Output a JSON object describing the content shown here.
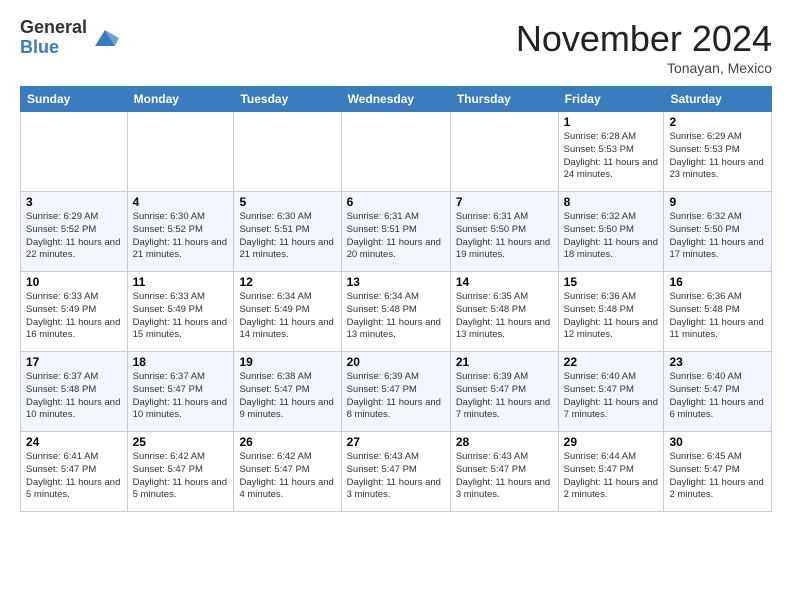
{
  "logo": {
    "general": "General",
    "blue": "Blue"
  },
  "header": {
    "month": "November 2024",
    "location": "Tonayan, Mexico"
  },
  "weekdays": [
    "Sunday",
    "Monday",
    "Tuesday",
    "Wednesday",
    "Thursday",
    "Friday",
    "Saturday"
  ],
  "weeks": [
    [
      {
        "day": "",
        "info": ""
      },
      {
        "day": "",
        "info": ""
      },
      {
        "day": "",
        "info": ""
      },
      {
        "day": "",
        "info": ""
      },
      {
        "day": "",
        "info": ""
      },
      {
        "day": "1",
        "info": "Sunrise: 6:28 AM\nSunset: 5:53 PM\nDaylight: 11 hours and 24 minutes."
      },
      {
        "day": "2",
        "info": "Sunrise: 6:29 AM\nSunset: 5:53 PM\nDaylight: 11 hours and 23 minutes."
      }
    ],
    [
      {
        "day": "3",
        "info": "Sunrise: 6:29 AM\nSunset: 5:52 PM\nDaylight: 11 hours and 22 minutes."
      },
      {
        "day": "4",
        "info": "Sunrise: 6:30 AM\nSunset: 5:52 PM\nDaylight: 11 hours and 21 minutes."
      },
      {
        "day": "5",
        "info": "Sunrise: 6:30 AM\nSunset: 5:51 PM\nDaylight: 11 hours and 21 minutes."
      },
      {
        "day": "6",
        "info": "Sunrise: 6:31 AM\nSunset: 5:51 PM\nDaylight: 11 hours and 20 minutes."
      },
      {
        "day": "7",
        "info": "Sunrise: 6:31 AM\nSunset: 5:50 PM\nDaylight: 11 hours and 19 minutes."
      },
      {
        "day": "8",
        "info": "Sunrise: 6:32 AM\nSunset: 5:50 PM\nDaylight: 11 hours and 18 minutes."
      },
      {
        "day": "9",
        "info": "Sunrise: 6:32 AM\nSunset: 5:50 PM\nDaylight: 11 hours and 17 minutes."
      }
    ],
    [
      {
        "day": "10",
        "info": "Sunrise: 6:33 AM\nSunset: 5:49 PM\nDaylight: 11 hours and 16 minutes."
      },
      {
        "day": "11",
        "info": "Sunrise: 6:33 AM\nSunset: 5:49 PM\nDaylight: 11 hours and 15 minutes."
      },
      {
        "day": "12",
        "info": "Sunrise: 6:34 AM\nSunset: 5:49 PM\nDaylight: 11 hours and 14 minutes."
      },
      {
        "day": "13",
        "info": "Sunrise: 6:34 AM\nSunset: 5:48 PM\nDaylight: 11 hours and 13 minutes."
      },
      {
        "day": "14",
        "info": "Sunrise: 6:35 AM\nSunset: 5:48 PM\nDaylight: 11 hours and 13 minutes."
      },
      {
        "day": "15",
        "info": "Sunrise: 6:36 AM\nSunset: 5:48 PM\nDaylight: 11 hours and 12 minutes."
      },
      {
        "day": "16",
        "info": "Sunrise: 6:36 AM\nSunset: 5:48 PM\nDaylight: 11 hours and 11 minutes."
      }
    ],
    [
      {
        "day": "17",
        "info": "Sunrise: 6:37 AM\nSunset: 5:48 PM\nDaylight: 11 hours and 10 minutes."
      },
      {
        "day": "18",
        "info": "Sunrise: 6:37 AM\nSunset: 5:47 PM\nDaylight: 11 hours and 10 minutes."
      },
      {
        "day": "19",
        "info": "Sunrise: 6:38 AM\nSunset: 5:47 PM\nDaylight: 11 hours and 9 minutes."
      },
      {
        "day": "20",
        "info": "Sunrise: 6:39 AM\nSunset: 5:47 PM\nDaylight: 11 hours and 8 minutes."
      },
      {
        "day": "21",
        "info": "Sunrise: 6:39 AM\nSunset: 5:47 PM\nDaylight: 11 hours and 7 minutes."
      },
      {
        "day": "22",
        "info": "Sunrise: 6:40 AM\nSunset: 5:47 PM\nDaylight: 11 hours and 7 minutes."
      },
      {
        "day": "23",
        "info": "Sunrise: 6:40 AM\nSunset: 5:47 PM\nDaylight: 11 hours and 6 minutes."
      }
    ],
    [
      {
        "day": "24",
        "info": "Sunrise: 6:41 AM\nSunset: 5:47 PM\nDaylight: 11 hours and 5 minutes."
      },
      {
        "day": "25",
        "info": "Sunrise: 6:42 AM\nSunset: 5:47 PM\nDaylight: 11 hours and 5 minutes."
      },
      {
        "day": "26",
        "info": "Sunrise: 6:42 AM\nSunset: 5:47 PM\nDaylight: 11 hours and 4 minutes."
      },
      {
        "day": "27",
        "info": "Sunrise: 6:43 AM\nSunset: 5:47 PM\nDaylight: 11 hours and 3 minutes."
      },
      {
        "day": "28",
        "info": "Sunrise: 6:43 AM\nSunset: 5:47 PM\nDaylight: 11 hours and 3 minutes."
      },
      {
        "day": "29",
        "info": "Sunrise: 6:44 AM\nSunset: 5:47 PM\nDaylight: 11 hours and 2 minutes."
      },
      {
        "day": "30",
        "info": "Sunrise: 6:45 AM\nSunset: 5:47 PM\nDaylight: 11 hours and 2 minutes."
      }
    ]
  ]
}
